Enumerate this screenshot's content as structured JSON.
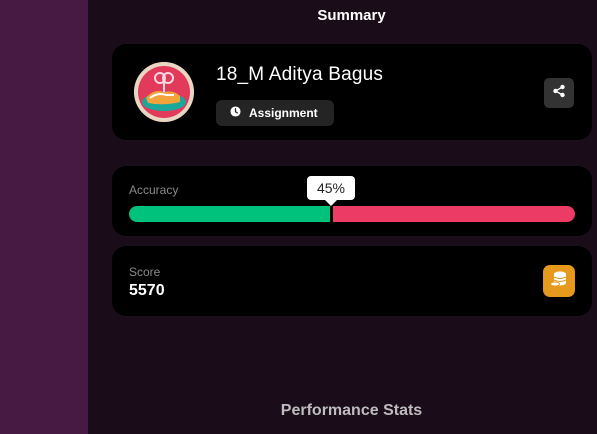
{
  "page": {
    "title": "Summary",
    "performance_heading": "Performance Stats"
  },
  "profile": {
    "name": "18_M Aditya Bagus",
    "badge_label": "Assignment",
    "badge_icon": "clock-icon",
    "share_icon": "share-icon"
  },
  "accuracy": {
    "label": "Accuracy",
    "percent_label": "45%",
    "fraction": 0.45,
    "correct_color": "#00c27c",
    "incorrect_color": "#ec3b64"
  },
  "score": {
    "label": "Score",
    "value": "5570",
    "icon": "coins-icon",
    "icon_bg": "#e59a1e"
  }
}
